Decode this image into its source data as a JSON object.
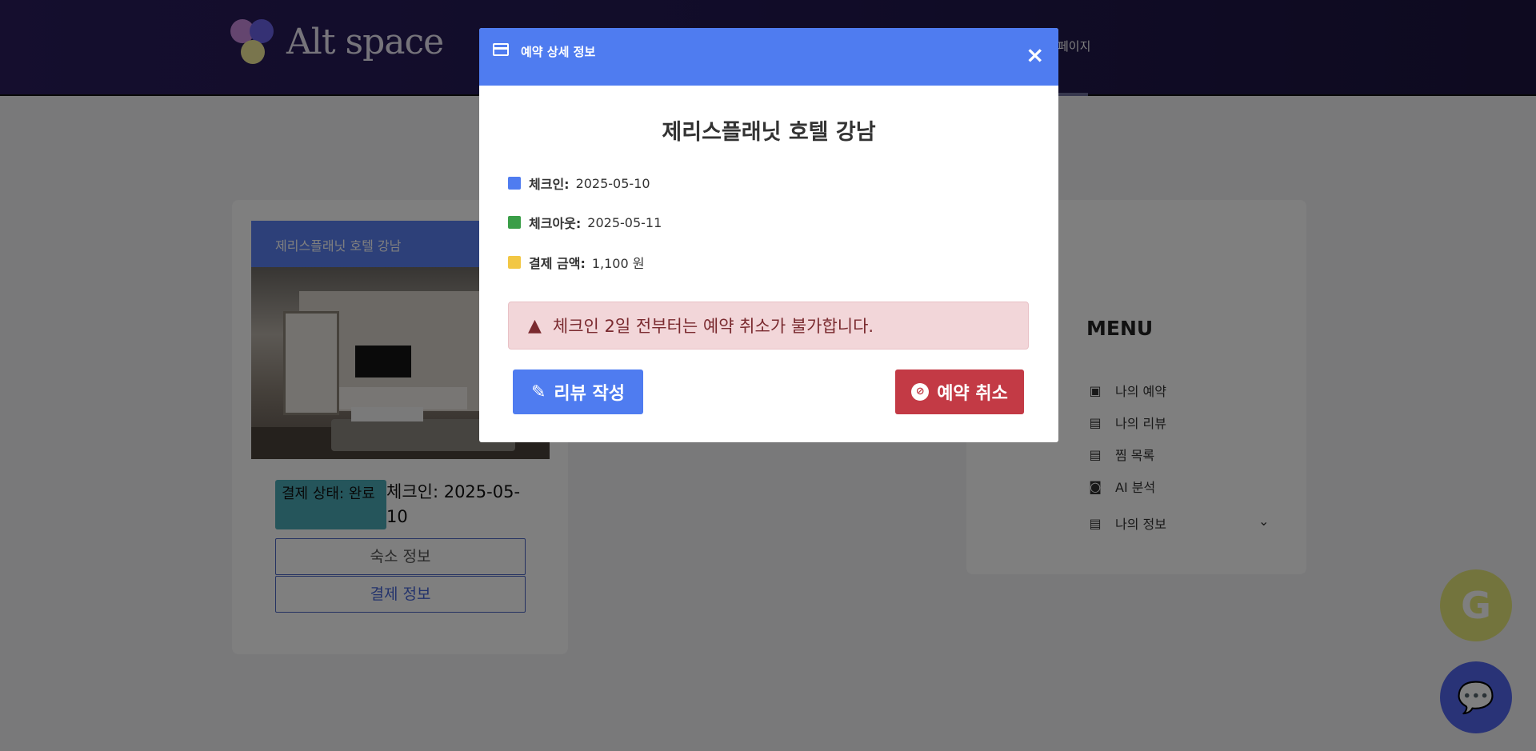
{
  "header": {
    "logo_text": "Alt space",
    "nav_mypage": "페이지"
  },
  "reservation_card": {
    "hotel_name": "제리스플래닛 호텔 강남",
    "payment_status": "결제 상태: 완료",
    "checkin": "체크인: 2025-05-10",
    "lodging_info_button": "숙소 정보",
    "payment_info_button": "결제 정보"
  },
  "menu": {
    "title": "MENU",
    "items": [
      {
        "label": "나의 예약",
        "icon": "calendar-check-icon"
      },
      {
        "label": "나의 리뷰",
        "icon": "review-icon"
      },
      {
        "label": "찜 목록",
        "icon": "list-icon"
      },
      {
        "label": "AI 분석",
        "icon": "robot-icon"
      },
      {
        "label": "나의 정보",
        "icon": "profile-icon"
      }
    ]
  },
  "modal": {
    "title": "예약 상세 정보",
    "close": "×",
    "hotel_name": "제리스플래닛 호텔 강남",
    "checkin_label": "체크인:",
    "checkin_value": "2025-05-10",
    "checkout_label": "체크아웃:",
    "checkout_value": "2025-05-11",
    "amount_label": "결제 금액:",
    "amount_value": "1,100 원",
    "alert": "체크인 2일 전부터는 예약 취소가 불가합니다.",
    "review_button": "리뷰 작성",
    "cancel_button": "예약 취소"
  },
  "fab": {
    "g_label": "G"
  },
  "colors": {
    "modal_header": "#4f7cf0",
    "cancel": "#c33a45",
    "alert_bg": "#f2d6d9"
  }
}
